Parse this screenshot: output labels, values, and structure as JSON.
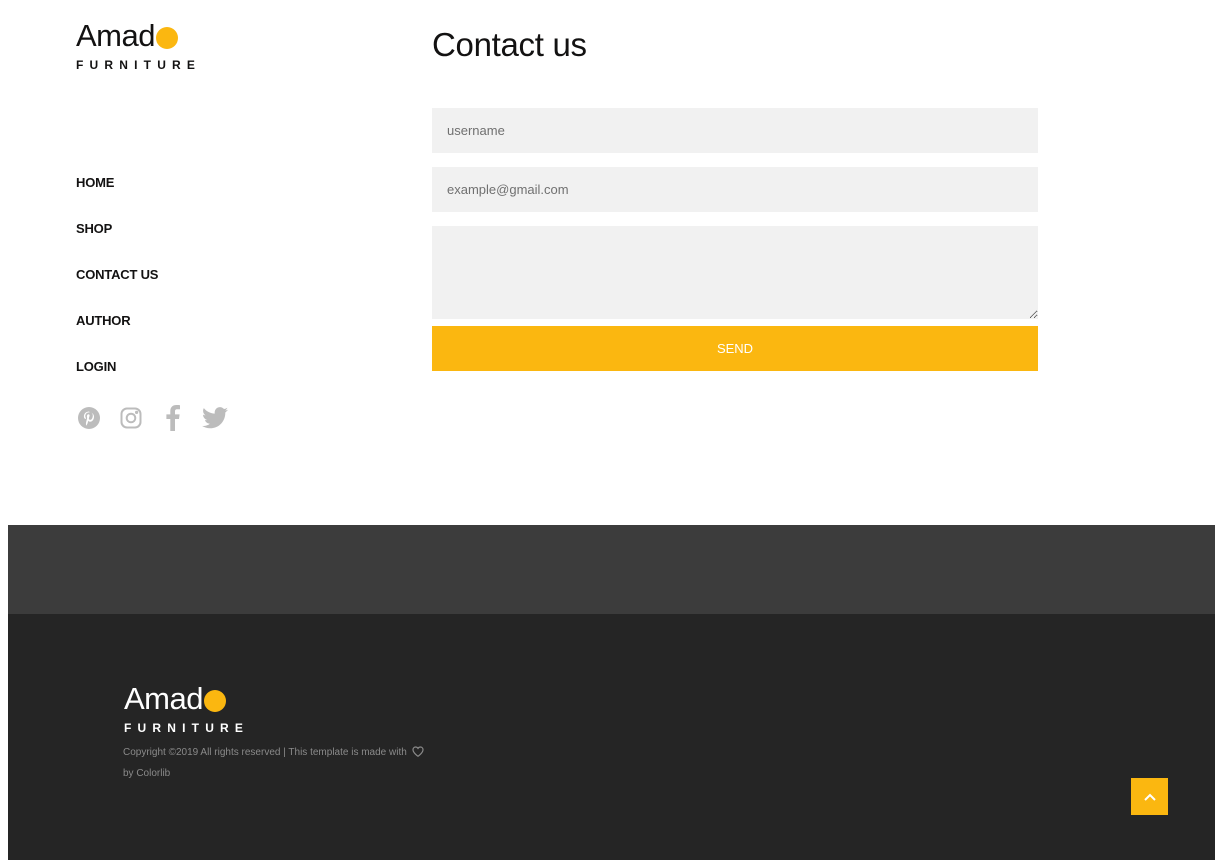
{
  "brand": {
    "name": "Amad",
    "subtitle": "FURNITURE",
    "accent_color": "#fbb710"
  },
  "nav": {
    "items": [
      {
        "label": "HOME"
      },
      {
        "label": "SHOP"
      },
      {
        "label": "CONTACT US"
      },
      {
        "label": "AUTHOR"
      },
      {
        "label": "LOGIN"
      }
    ]
  },
  "social": {
    "icons": [
      "pinterest-icon",
      "instagram-icon",
      "facebook-icon",
      "twitter-icon"
    ],
    "color": "#bcbcbc"
  },
  "contact": {
    "title": "Contact us",
    "username_placeholder": "username",
    "email_placeholder": "example@gmail.com",
    "message_placeholder": "",
    "send_label": "SEND"
  },
  "footer": {
    "upper_color": "#3c3c3c",
    "lower_color": "#252525",
    "copyright_part1": "Copyright ©2019 All rights reserved | This template is made with",
    "copyright_part2": "by Colorlib",
    "back_to_top_icon": "chevron-up-icon"
  }
}
